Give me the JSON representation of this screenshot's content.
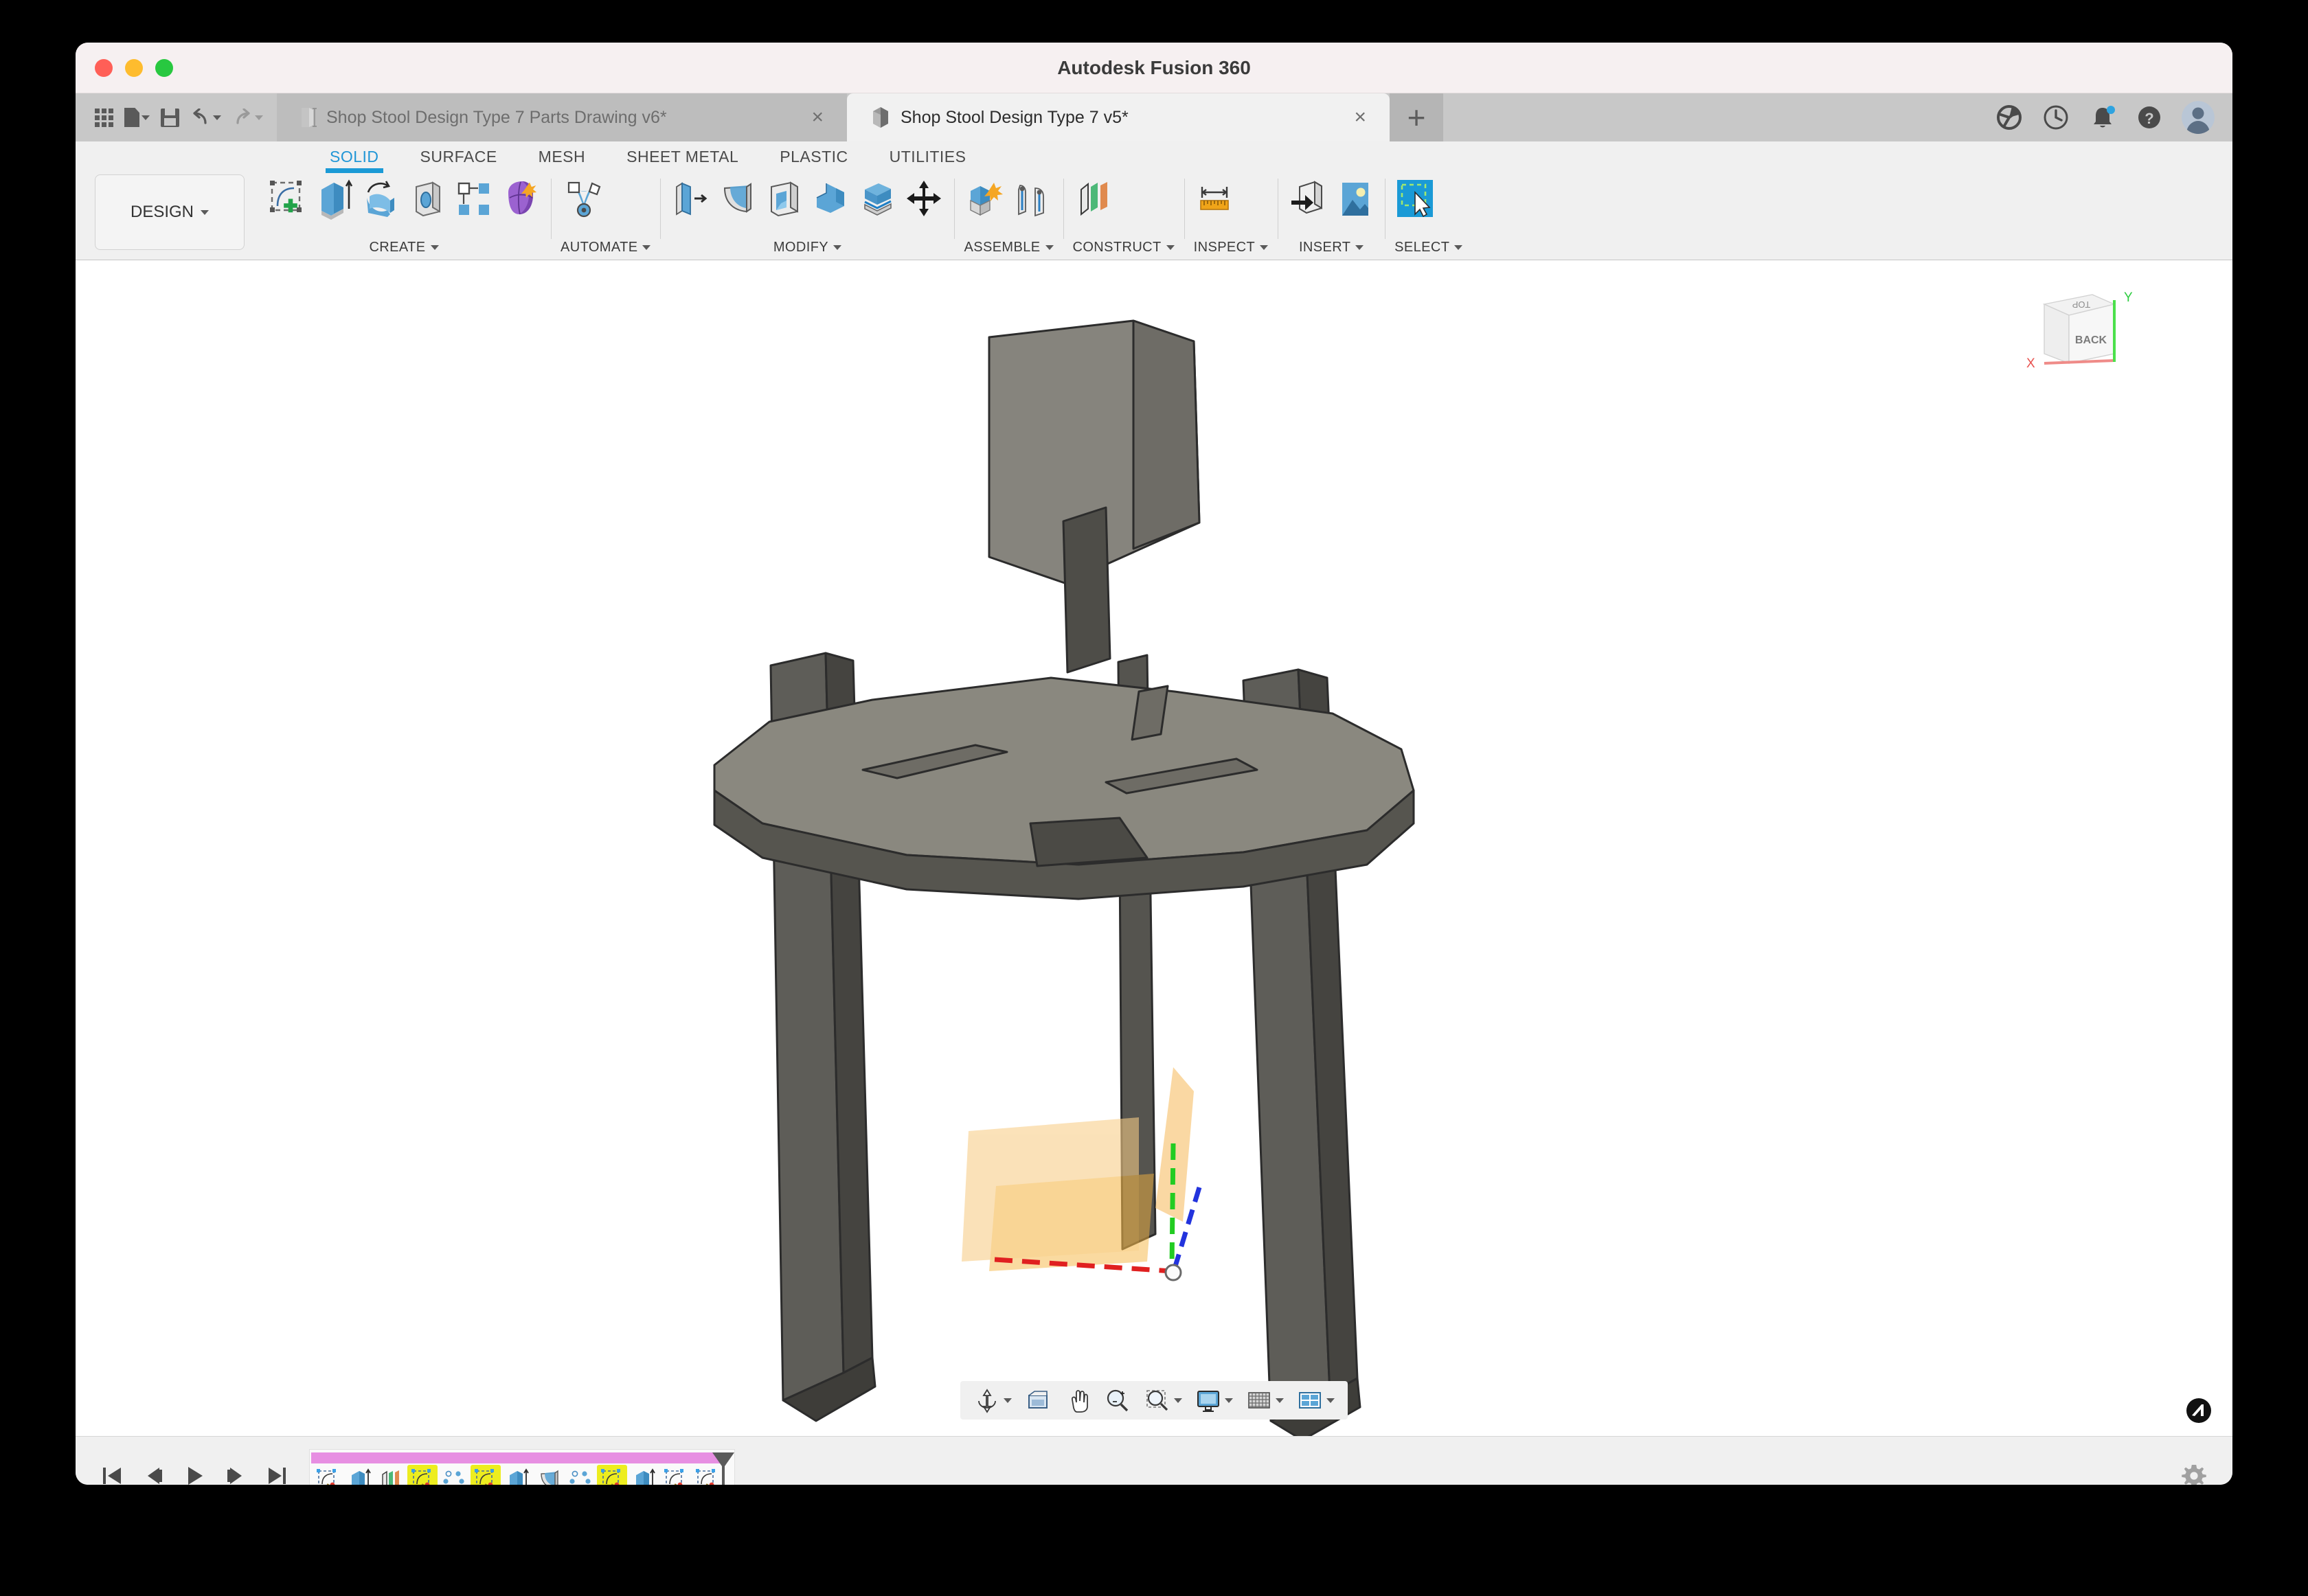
{
  "window": {
    "title": "Autodesk Fusion 360",
    "traffic_lights": [
      "close",
      "minimize",
      "maximize"
    ]
  },
  "quick_access": [
    {
      "name": "app-grid-icon",
      "label": "Show Data Panel"
    },
    {
      "name": "file-icon",
      "label": "File",
      "has_caret": true
    },
    {
      "name": "save-icon",
      "label": "Save"
    },
    {
      "name": "undo-icon",
      "label": "Undo",
      "has_caret": true
    },
    {
      "name": "redo-icon",
      "label": "Redo",
      "has_caret": true
    }
  ],
  "tabs": [
    {
      "label": "Shop Stool Design Type 7 Parts Drawing v6*",
      "icon": "drawing-icon",
      "active": false,
      "closable": true
    },
    {
      "label": "Shop Stool Design Type 7 v5*",
      "icon": "cube-icon",
      "active": true,
      "closable": true
    }
  ],
  "tab_new_label": "+",
  "tab_close_glyph": "×",
  "top_right_icons": [
    {
      "name": "extensions-icon",
      "label": "Extensions"
    },
    {
      "name": "job-status-icon",
      "label": "Job Status"
    },
    {
      "name": "notifications-bell-icon",
      "label": "Notifications",
      "badge": true
    },
    {
      "name": "help-icon",
      "label": "Help"
    },
    {
      "name": "account-avatar",
      "label": "Account"
    }
  ],
  "ribbon": {
    "workspace": "DESIGN",
    "tabs": [
      {
        "label": "SOLID",
        "active": true
      },
      {
        "label": "SURFACE",
        "active": false
      },
      {
        "label": "MESH",
        "active": false
      },
      {
        "label": "SHEET METAL",
        "active": false
      },
      {
        "label": "PLASTIC",
        "active": false
      },
      {
        "label": "UTILITIES",
        "active": false
      }
    ],
    "panels": [
      {
        "label": "CREATE",
        "dropdown": true,
        "tools": [
          {
            "name": "create-sketch-icon",
            "label": "Create Sketch"
          },
          {
            "name": "extrude-icon",
            "label": "Extrude"
          },
          {
            "name": "revolve-icon",
            "label": "Revolve"
          },
          {
            "name": "hole-icon",
            "label": "Hole"
          },
          {
            "name": "pattern-icon",
            "label": "Rectangular Pattern"
          },
          {
            "name": "create-form-icon",
            "label": "Create Form"
          }
        ]
      },
      {
        "label": "AUTOMATE",
        "dropdown": true,
        "tools": [
          {
            "name": "automate-generative-icon",
            "label": "Automated Modeling"
          }
        ]
      },
      {
        "label": "MODIFY",
        "dropdown": true,
        "tools": [
          {
            "name": "press-pull-icon",
            "label": "Press Pull"
          },
          {
            "name": "fillet-icon",
            "label": "Fillet"
          },
          {
            "name": "shell-icon",
            "label": "Shell"
          },
          {
            "name": "combine-icon",
            "label": "Combine"
          },
          {
            "name": "split-face-icon",
            "label": "Split Body"
          },
          {
            "name": "move-copy-icon",
            "label": "Move/Copy"
          }
        ]
      },
      {
        "label": "ASSEMBLE",
        "dropdown": true,
        "tools": [
          {
            "name": "new-component-icon",
            "label": "New Component"
          },
          {
            "name": "joint-icon",
            "label": "Joint"
          }
        ]
      },
      {
        "label": "CONSTRUCT",
        "dropdown": true,
        "tools": [
          {
            "name": "offset-plane-icon",
            "label": "Offset Plane"
          }
        ]
      },
      {
        "label": "INSPECT",
        "dropdown": true,
        "tools": [
          {
            "name": "measure-icon",
            "label": "Measure"
          }
        ]
      },
      {
        "label": "INSERT",
        "dropdown": true,
        "tools": [
          {
            "name": "insert-derive-icon",
            "label": "Derive"
          },
          {
            "name": "insert-canvas-icon",
            "label": "Canvas"
          }
        ]
      },
      {
        "label": "SELECT",
        "dropdown": true,
        "tools": [
          {
            "name": "select-cursor-icon",
            "label": "Select",
            "active": true
          }
        ]
      }
    ]
  },
  "viewport": {
    "background": "#ffffff",
    "model_name": "shop-stool-3d-model",
    "model_color": "#82807a",
    "viewcube": {
      "front_face": "BACK",
      "top_face": "TOP",
      "axis_x_label": "X",
      "axis_y_label": "Y",
      "axis_x_color": "#e8524f",
      "axis_y_color": "#2ecc40"
    },
    "origin": {
      "x_axis_color": "#e02020",
      "y_axis_color": "#22cc22",
      "z_axis_color": "#2233dd",
      "plane_color": "#f5bb55"
    },
    "nav_bar": [
      {
        "name": "orbit-icon",
        "label": "Orbit",
        "has_caret": true
      },
      {
        "name": "look-at-icon",
        "label": "Look At",
        "has_caret": false
      },
      {
        "name": "pan-icon",
        "label": "Pan",
        "has_caret": false
      },
      {
        "name": "zoom-icon",
        "label": "Zoom",
        "has_caret": false
      },
      {
        "name": "zoom-window-icon",
        "label": "Fit",
        "has_caret": true
      },
      {
        "name": "display-settings-icon",
        "label": "Display Settings",
        "has_caret": true
      },
      {
        "name": "grid-snaps-icon",
        "label": "Grid and Snaps",
        "has_caret": true
      },
      {
        "name": "viewports-icon",
        "label": "Viewports",
        "has_caret": true
      }
    ],
    "brand_badge": "autodesk-logo-icon"
  },
  "timeline": {
    "playback": [
      {
        "name": "go-to-beginning-button",
        "label": "Go to Beginning"
      },
      {
        "name": "step-back-button",
        "label": "Step Back"
      },
      {
        "name": "play-button",
        "label": "Play"
      },
      {
        "name": "step-forward-button",
        "label": "Step Forward"
      },
      {
        "name": "go-to-end-button",
        "label": "Go to End"
      }
    ],
    "group_bar_color": "#e78fe2",
    "highlight_color": "#eded1f",
    "features": [
      {
        "name": "sketch-feature",
        "type": "sketch",
        "highlighted": false
      },
      {
        "name": "extrude-feature",
        "type": "extrude",
        "highlighted": false
      },
      {
        "name": "plane-feature",
        "type": "plane",
        "highlighted": false
      },
      {
        "name": "sketch-feature",
        "type": "sketch",
        "highlighted": true
      },
      {
        "name": "pattern-feature",
        "type": "pattern",
        "highlighted": false
      },
      {
        "name": "sketch-feature",
        "type": "sketch",
        "highlighted": true
      },
      {
        "name": "extrude-feature",
        "type": "extrude",
        "highlighted": false
      },
      {
        "name": "fillet-feature",
        "type": "fillet",
        "highlighted": false
      },
      {
        "name": "pattern-feature",
        "type": "pattern",
        "highlighted": false
      },
      {
        "name": "sketch-feature",
        "type": "sketch",
        "highlighted": true
      },
      {
        "name": "extrude-feature",
        "type": "extrude",
        "highlighted": false
      },
      {
        "name": "sketch-feature",
        "type": "sketch",
        "highlighted": false
      },
      {
        "name": "sketch-feature",
        "type": "sketch",
        "highlighted": false
      }
    ],
    "settings_icon": "settings-gear-icon"
  }
}
